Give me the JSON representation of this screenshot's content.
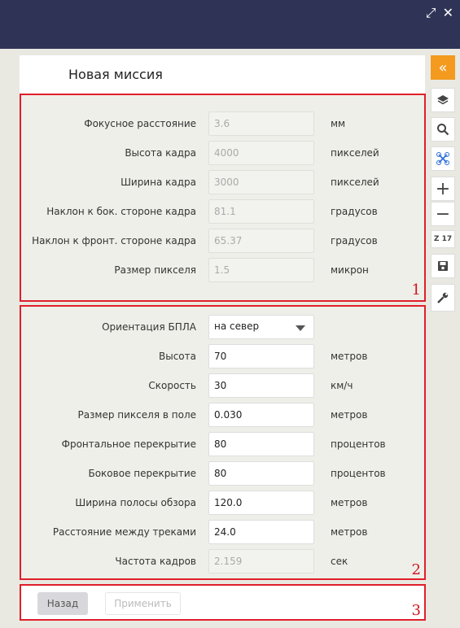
{
  "window": {
    "icons": [
      "expand-icon",
      "close-icon"
    ]
  },
  "title": "Новая миссия",
  "camera": [
    {
      "label": "Фокусное расстояние",
      "value": "3.6",
      "unit": "мм"
    },
    {
      "label": "Высота кадра",
      "value": "4000",
      "unit": "пикселей"
    },
    {
      "label": "Ширина кадра",
      "value": "3000",
      "unit": "пикселей"
    },
    {
      "label": "Наклон к бок. стороне кадра",
      "value": "81.1",
      "unit": "градусов"
    },
    {
      "label": "Наклон к фронт. стороне кадра",
      "value": "65.37",
      "unit": "градусов"
    },
    {
      "label": "Размер пикселя",
      "value": "1.5",
      "unit": "микрон"
    }
  ],
  "flight": {
    "orientation": {
      "label": "Ориентация БПЛА",
      "value": "на север"
    },
    "fields": [
      {
        "label": "Высота",
        "value": "70",
        "unit": "метров"
      },
      {
        "label": "Скорость",
        "value": "30",
        "unit": "км/ч"
      },
      {
        "label": "Размер пикселя в поле",
        "value": "0.030",
        "unit": "метров"
      },
      {
        "label": "Фронтальное перекрытие",
        "value": "80",
        "unit": "процентов"
      },
      {
        "label": "Боковое перекрытие",
        "value": "80",
        "unit": "процентов"
      },
      {
        "label": "Ширина полосы обзора",
        "value": "120.0",
        "unit": "метров"
      },
      {
        "label": "Расстояние между треками",
        "value": "24.0",
        "unit": "метров"
      }
    ],
    "frame_rate": {
      "label": "Частота кадров",
      "value": "2.159",
      "unit": "сек"
    }
  },
  "buttons": {
    "back": "Назад",
    "apply": "Применить"
  },
  "section_numbers": [
    "1",
    "2",
    "3"
  ],
  "sidebar": {
    "zoom_label": "Z 17"
  },
  "colors": {
    "accent": "#f39a1f",
    "header": "#2f3456",
    "highlight": "#e01f2a"
  }
}
